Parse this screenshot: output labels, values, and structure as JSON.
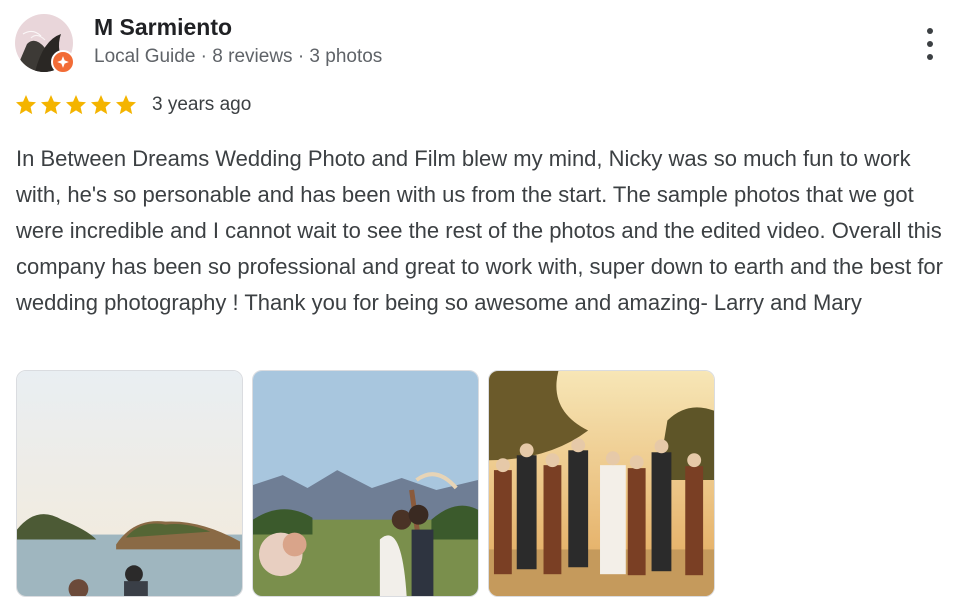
{
  "reviewer": {
    "name": "M Sarmiento",
    "meta": "Local Guide · 8 reviews · 3 photos",
    "avatar_icon": "profile-photo",
    "badge_icon": "local-guide-star-icon",
    "badge_color": "#f26c36"
  },
  "review": {
    "rating": 5,
    "rating_max": 5,
    "star_color": "#f4b400",
    "time": "3 years ago",
    "text": "In Between Dreams Wedding Photo and Film blew my mind, Nicky was so much fun to work with, he's so personable and has been with us from the start. The sample photos that we got were incredible and I cannot wait to see the rest of the photos and the edited video. Overall this company has been so professional and great to work with, super down to earth and the best for wedding photography ! Thank you for being so awesome and amazing- Larry and Mary"
  },
  "actions": {
    "more_icon": "more-vert-icon"
  },
  "photos": [
    {
      "name": "photo-couple-by-water"
    },
    {
      "name": "photo-couple-kiss-mountains"
    },
    {
      "name": "photo-wedding-party-sunset"
    }
  ]
}
